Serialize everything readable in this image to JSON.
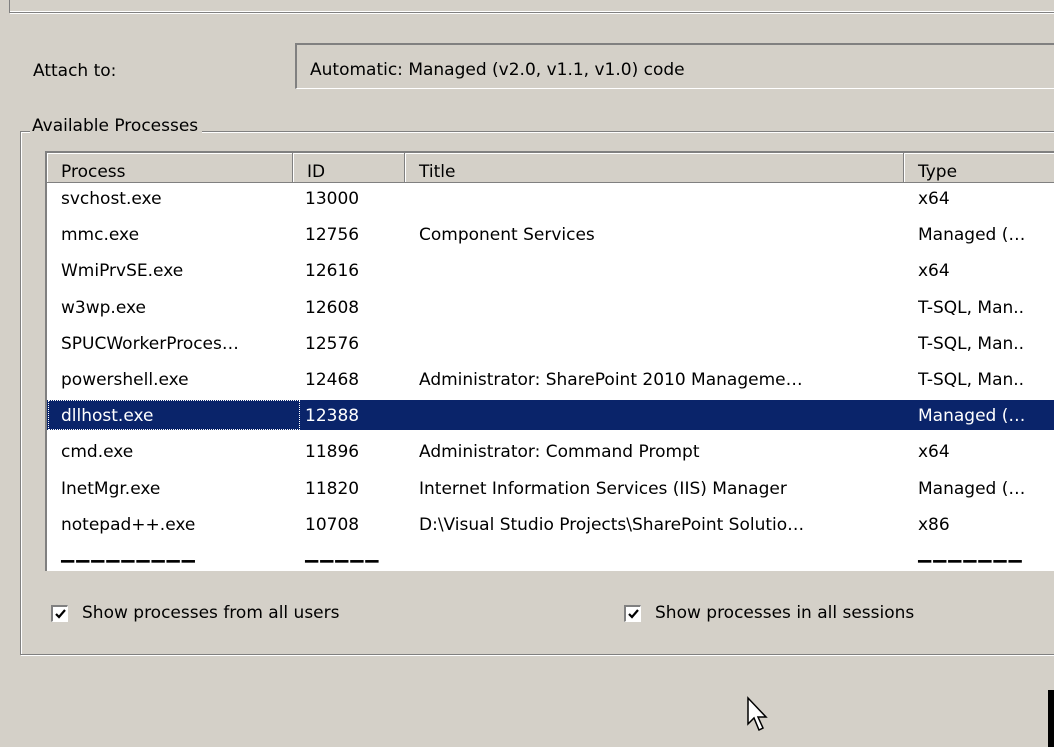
{
  "attach": {
    "label": "Attach to:",
    "value": "Automatic: Managed (v2.0, v1.1, v1.0) code"
  },
  "available_processes": {
    "legend": "Available Processes",
    "columns": [
      "Process",
      "ID",
      "Title",
      "Type"
    ],
    "rows": [
      {
        "process": "svchost.exe",
        "id": "13000",
        "title": "",
        "type": "x64"
      },
      {
        "process": "mmc.exe",
        "id": "12756",
        "title": "Component Services",
        "type": "Managed (…"
      },
      {
        "process": "WmiPrvSE.exe",
        "id": "12616",
        "title": "",
        "type": "x64"
      },
      {
        "process": "w3wp.exe",
        "id": "12608",
        "title": "",
        "type": "T-SQL, Man.."
      },
      {
        "process": "SPUCWorkerProces…",
        "id": "12576",
        "title": "",
        "type": "T-SQL, Man.."
      },
      {
        "process": "powershell.exe",
        "id": "12468",
        "title": "Administrator: SharePoint 2010 Manageme…",
        "type": "T-SQL, Man.."
      },
      {
        "process": "dllhost.exe",
        "id": "12388",
        "title": "",
        "type": "Managed (…",
        "selected": true
      },
      {
        "process": "cmd.exe",
        "id": "11896",
        "title": "Administrator: Command Prompt",
        "type": "x64"
      },
      {
        "process": "InetMgr.exe",
        "id": "11820",
        "title": "Internet Information Services (IIS) Manager",
        "type": "Managed (…"
      },
      {
        "process": "notepad++.exe",
        "id": "10708",
        "title": "D:\\Visual Studio Projects\\SharePoint Solutio…",
        "type": "x86"
      }
    ]
  },
  "options": {
    "show_all_users": {
      "label": "Show processes from all users",
      "checked": true
    },
    "show_all_sessions": {
      "label": "Show processes in all sessions",
      "checked": true
    }
  },
  "colors": {
    "dialog_bg": "#d4d0c8",
    "selection_bg": "#0a246a",
    "list_bg": "#ffffff"
  },
  "icons": [
    "checkmark-icon",
    "mouse-pointer-icon"
  ]
}
